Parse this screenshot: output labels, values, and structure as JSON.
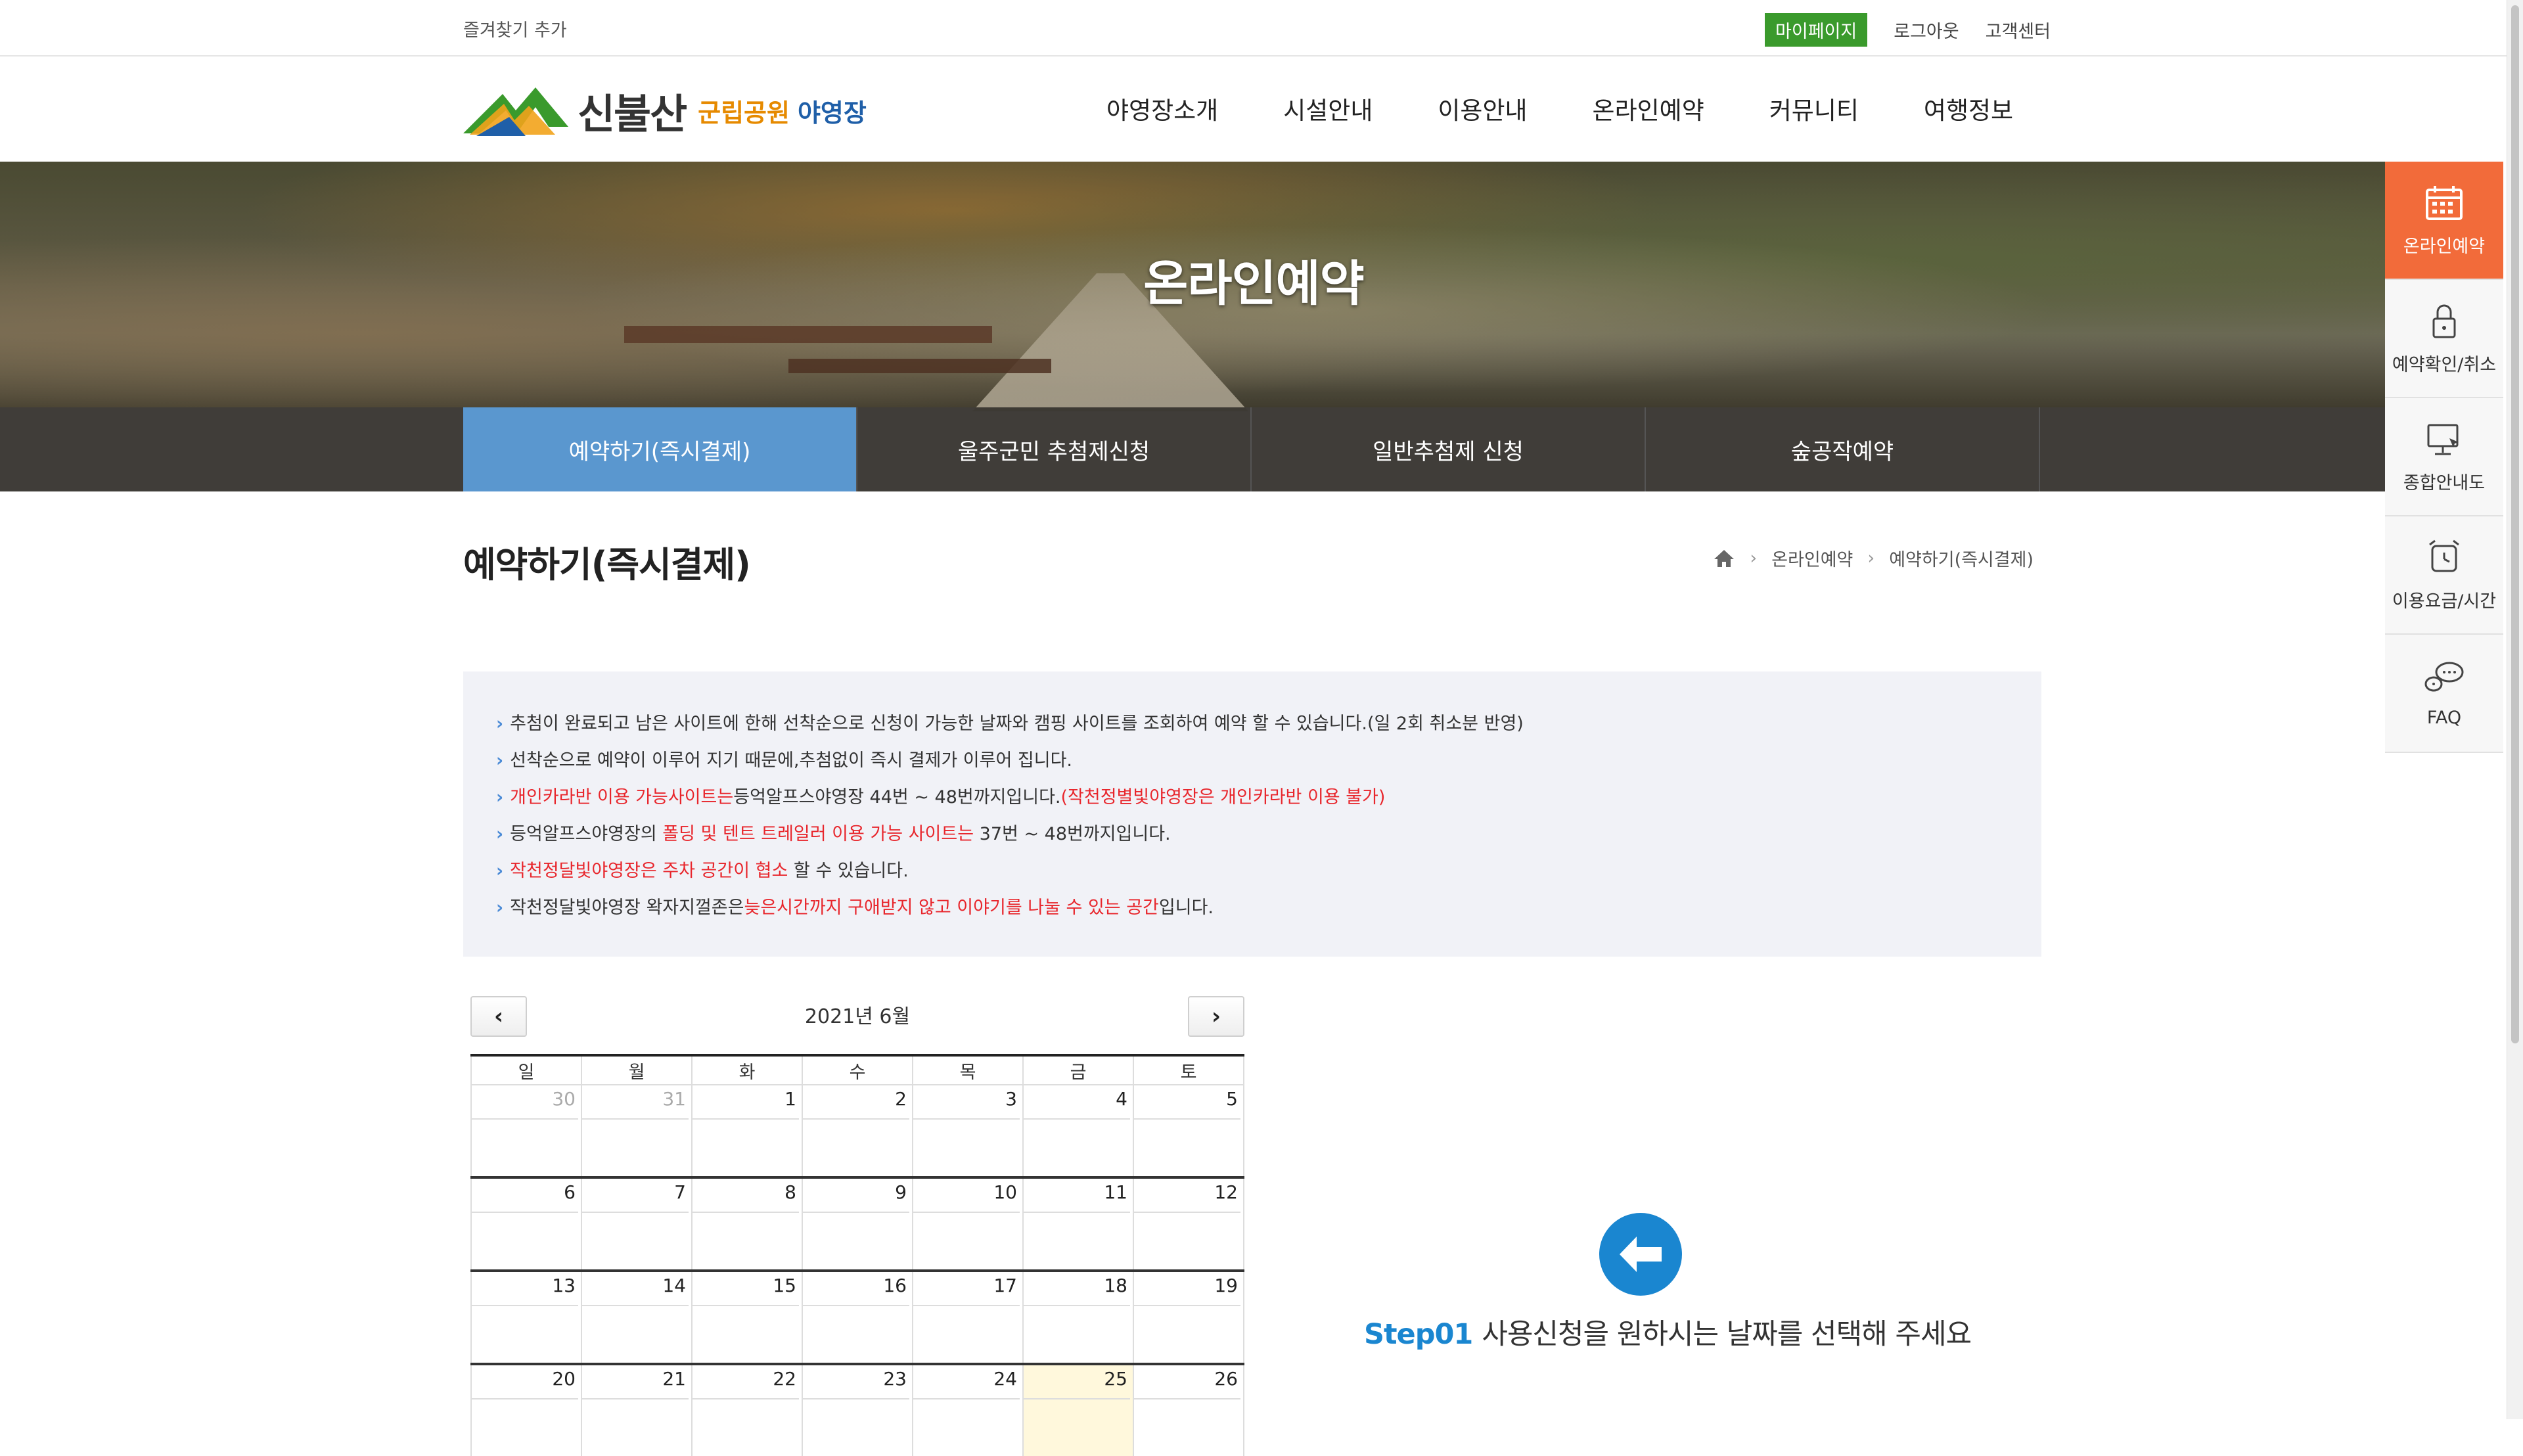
{
  "topbar": {
    "favorite": "즐겨찾기 추가",
    "mypage": "마이페이지",
    "logout": "로그아웃",
    "support": "고객센터"
  },
  "logo": {
    "name": "신불산",
    "park": "군립공원",
    "camp": "야영장"
  },
  "gnb": [
    "야영장소개",
    "시설안내",
    "이용안내",
    "온라인예약",
    "커뮤니티",
    "여행정보"
  ],
  "banner": {
    "title": "온라인예약"
  },
  "subtabs": [
    "예약하기(즉시결제)",
    "울주군민 추첨제신청",
    "일반추첨제 신청",
    "숲공작예약"
  ],
  "page": {
    "title": "예약하기(즉시결제)"
  },
  "breadcrumb": {
    "level1": "온라인예약",
    "level2": "예약하기(즉시결제)"
  },
  "quick": [
    "온라인예약",
    "예약확인/취소",
    "종합안내도",
    "이용요금/시간",
    "FAQ"
  ],
  "notice": {
    "l1": "추첨이 완료되고 남은 사이트에 한해 선착순으로 신청이 가능한 날짜와 캠핑 사이트를 조회하여 예약 할 수 있습니다.(일 2회 취소분 반영)",
    "l2": "선착순으로 예약이 이루어 지기 때문에,추첨없이 즉시 결제가 이루어 집니다.",
    "l3a": "개인카라반 이용 가능사이트는",
    "l3b": "등억알프스야영장 44번 ~ 48번까지입니다.",
    "l3c": "(작천정별빛야영장은 개인카라반 이용 불가)",
    "l4a": "등억알프스야영장의 ",
    "l4b": "폴딩 및 텐트 트레일러 이용 가능 사이트는",
    "l4c": " 37번 ~ 48번까지입니다.",
    "l5a": "작천정달빛야영장은 주차 공간이 협소",
    "l5b": " 할 수 있습니다.",
    "l6a": "작천정달빛야영장 왁자지껄존은",
    "l6b": "늦은시간까지 구애받지 않고 이야기를 나눌 수 있는 공간",
    "l6c": "입니다."
  },
  "calendar": {
    "month": "2021년 6월",
    "weekdays": [
      "일",
      "월",
      "화",
      "수",
      "목",
      "금",
      "토"
    ],
    "weeks": [
      [
        "30",
        "31",
        "1",
        "2",
        "3",
        "4",
        "5"
      ],
      [
        "6",
        "7",
        "8",
        "9",
        "10",
        "11",
        "12"
      ],
      [
        "13",
        "14",
        "15",
        "16",
        "17",
        "18",
        "19"
      ],
      [
        "20",
        "21",
        "22",
        "23",
        "24",
        "25",
        "26"
      ]
    ]
  },
  "step": {
    "label": "Step01",
    "text": "사용신청을 원하시는 날짜를 선택해 주세요"
  }
}
